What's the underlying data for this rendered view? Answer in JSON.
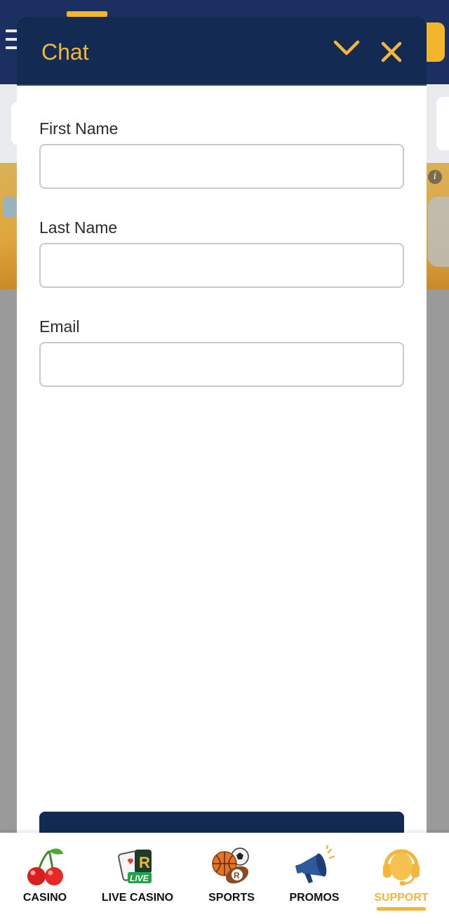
{
  "chat": {
    "title": "Chat",
    "icons": {
      "collapse": "chevron-down-icon",
      "close": "close-icon"
    },
    "fields": [
      {
        "label": "First Name",
        "value": "",
        "placeholder": ""
      },
      {
        "label": "Last Name",
        "value": "",
        "placeholder": ""
      },
      {
        "label": "Email",
        "value": "",
        "placeholder": ""
      }
    ]
  },
  "bottom_nav": {
    "items": [
      {
        "label": "CASINO",
        "icon": "cherry-icon"
      },
      {
        "label": "LIVE CASINO",
        "icon": "live-casino-cards-icon"
      },
      {
        "label": "SPORTS",
        "icon": "sports-balls-icon"
      },
      {
        "label": "PROMOS",
        "icon": "megaphone-icon"
      },
      {
        "label": "SUPPORT",
        "icon": "headset-icon",
        "active": true
      }
    ]
  },
  "colors": {
    "header_navy": "#132a52",
    "accent_gold": "#f4b63a",
    "page_navy": "#1b3060"
  }
}
